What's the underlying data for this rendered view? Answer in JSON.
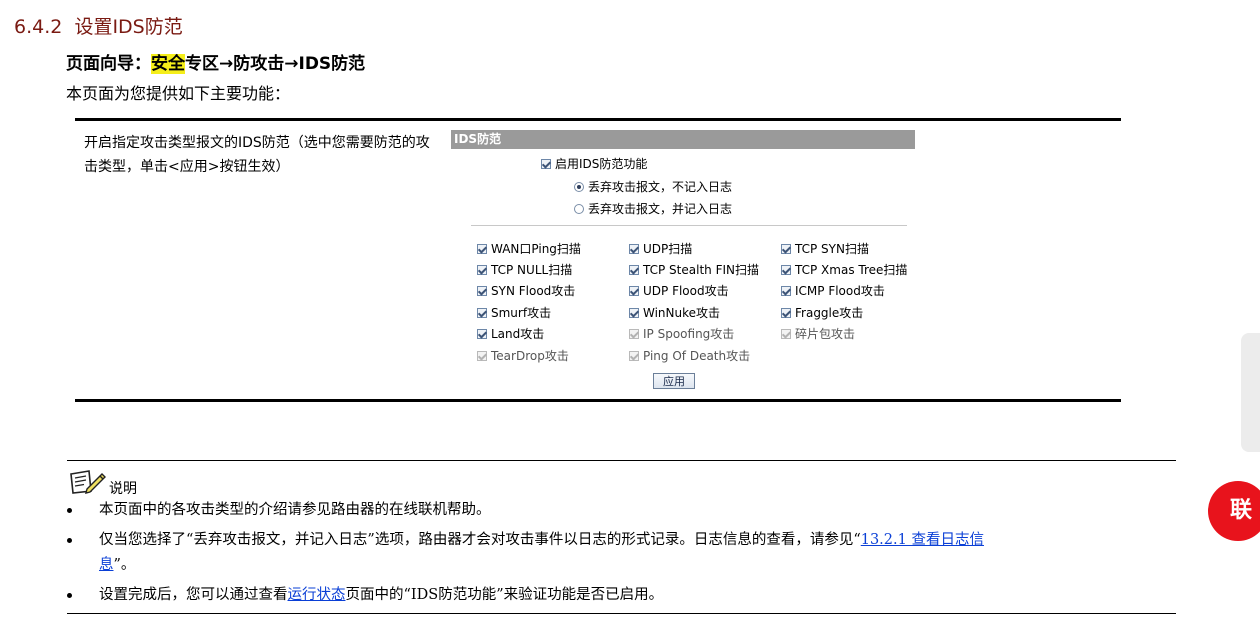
{
  "section": {
    "number": "6.4.2",
    "title": "设置IDS防范"
  },
  "guide": {
    "prefix": "页面向导：",
    "highlight": "安全",
    "rest": "专区→防攻击→IDS防范"
  },
  "intro": "本页面为您提供如下主要功能：",
  "func": {
    "description": "开启指定攻击类型报文的IDS防范（选中您需要防范的攻击类型，单击<应用>按钮生效）"
  },
  "panel": {
    "title": "IDS防范",
    "enable_label": "启用IDS防范功能",
    "radio_options": [
      {
        "label": "丢弃攻击报文，不记入日志",
        "selected": true
      },
      {
        "label": "丢弃攻击报文，并记入日志",
        "selected": false
      }
    ],
    "items": [
      {
        "label": "WAN口Ping扫描",
        "disabled": false
      },
      {
        "label": "UDP扫描",
        "disabled": false
      },
      {
        "label": "TCP SYN扫描",
        "disabled": false
      },
      {
        "label": "TCP NULL扫描",
        "disabled": false
      },
      {
        "label": "TCP Stealth FIN扫描",
        "disabled": false
      },
      {
        "label": "TCP Xmas Tree扫描",
        "disabled": false
      },
      {
        "label": "SYN Flood攻击",
        "disabled": false
      },
      {
        "label": "UDP Flood攻击",
        "disabled": false
      },
      {
        "label": "ICMP Flood攻击",
        "disabled": false
      },
      {
        "label": "Smurf攻击",
        "disabled": false
      },
      {
        "label": "WinNuke攻击",
        "disabled": false
      },
      {
        "label": "Fraggle攻击",
        "disabled": false
      },
      {
        "label": "Land攻击",
        "disabled": false
      },
      {
        "label": "IP Spoofing攻击",
        "disabled": true
      },
      {
        "label": "碎片包攻击",
        "disabled": true
      },
      {
        "label": "TearDrop攻击",
        "disabled": true
      },
      {
        "label": "Ping Of Death攻击",
        "disabled": true
      }
    ],
    "apply_label": "应用"
  },
  "note": {
    "label": "说明",
    "b1": "本页面中的各攻击类型的介绍请参见路由器的在线联机帮助。",
    "b2_before": "仅当您选择了“丢弃攻击报文，并记入日志”选项，路由器才会对攻击事件以日志的形式记录。日志信息的查看，请参见“",
    "b2_link1": "13.2.1  查看日志信",
    "b2_link2": "息",
    "b2_after": "”。",
    "b3_before": "设置完成后，您可以通过查看",
    "b3_link": "运行状态",
    "b3_after": "页面中的“IDS防范功能”来验证功能是否已启用。"
  },
  "side_button": "联"
}
